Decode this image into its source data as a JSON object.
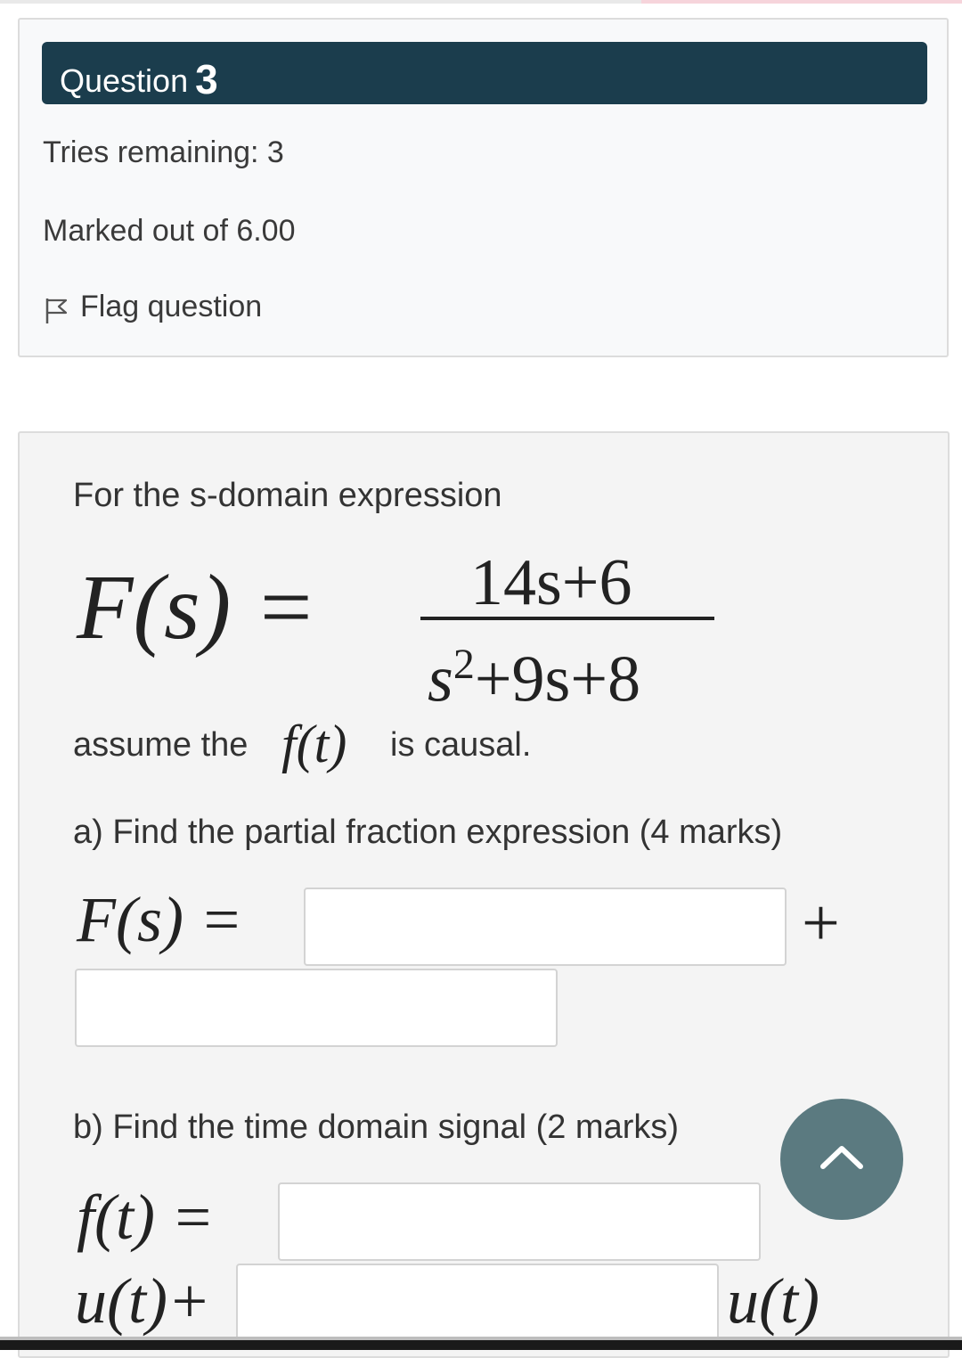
{
  "question": {
    "label": "Question",
    "number": "3",
    "tries": "Tries remaining: 3",
    "marked": "Marked out of 6.00",
    "flag_label": "Flag question",
    "flag_icon": "flag-icon"
  },
  "body": {
    "intro": "For the s-domain expression",
    "eq_lhs": "F(s) =",
    "eq_numerator": "14s+6",
    "eq_denominator_base": "s",
    "eq_denominator_exp": "2",
    "eq_denominator_rest": "+9s+8",
    "assume_prefix": "assume the",
    "assume_math": "f(t)",
    "assume_suffix": "is causal.",
    "part_a": "a) Find the partial fraction  expression (4 marks)",
    "part_a_lhs": "F(s) =",
    "part_a_plus": "+",
    "part_b": "b) Find the time domain signal (2 marks)",
    "part_b_lhs": "f(t) =",
    "part_b_u1": "u(t)+",
    "part_b_u2": "u(t)"
  },
  "inputs": {
    "a1": "",
    "a2": "",
    "b1": "",
    "b2": ""
  },
  "scroll_button": {
    "icon": "chevron-up-icon"
  },
  "colors": {
    "header_bar": "#1b3d4d",
    "scroll_button": "#5b7a80",
    "card_bg": "#f4f4f4"
  }
}
